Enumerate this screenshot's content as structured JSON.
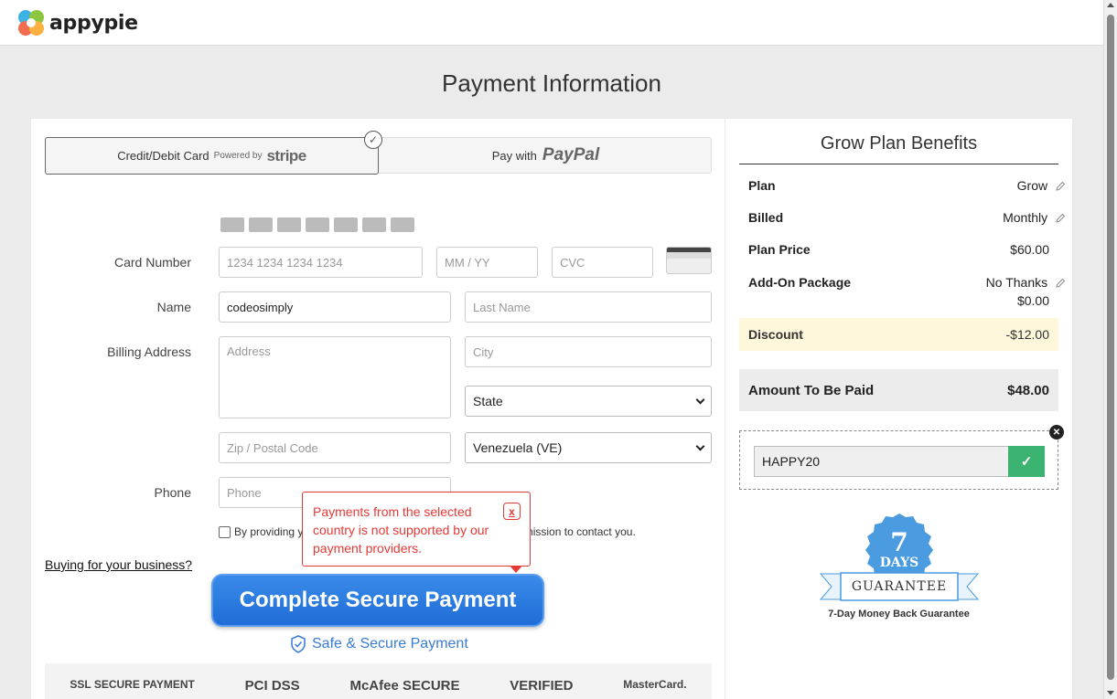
{
  "brand": {
    "name": "appypie"
  },
  "page": {
    "title": "Payment Information"
  },
  "tabs": {
    "card_label": "Credit/Debit Card",
    "powered_by": "Powered by",
    "stripe": "stripe",
    "paypal_prefix": "Pay with",
    "paypal": "PayPal"
  },
  "card_icons": [
    "Maestro",
    "VISA",
    "MasterCard",
    "American Express",
    "Diners",
    "DISCOVER",
    "JCB"
  ],
  "form": {
    "card_number_label": "Card Number",
    "card_number_placeholder": "1234 1234 1234 1234",
    "expiry_placeholder": "MM / YY",
    "cvc_placeholder": "CVC",
    "name_label": "Name",
    "first_name_value": "codeosimply",
    "last_name_placeholder": "Last Name",
    "billing_label": "Billing Address",
    "address_placeholder": "Address",
    "city_placeholder": "City",
    "state_value": "State",
    "zip_placeholder": "Zip / Postal Code",
    "country_value": "Venezuela (VE)",
    "phone_label": "Phone",
    "phone_placeholder": "Phone",
    "consent_start": "By providing y",
    "consent_end": "permission to contact you."
  },
  "business_link": "Buying for your business?",
  "pay_button": "Complete Secure Payment",
  "secure_text": "Safe & Secure Payment",
  "trust_badges": [
    "SSL SECURE PAYMENT",
    "PCI DSS",
    "McAfee SECURE",
    "VERIFIED",
    "MasterCard."
  ],
  "tooltip": {
    "message": "Payments from the selected country is not supported by our payment providers.",
    "close": "x"
  },
  "benefits": {
    "title": "Grow Plan Benefits",
    "plan_label": "Plan",
    "plan_value": "Grow",
    "billed_label": "Billed",
    "billed_value": "Monthly",
    "price_label": "Plan Price",
    "price_value": "$60.00",
    "addon_label": "Add-On Package",
    "addon_value": "No Thanks",
    "addon_price": "$0.00",
    "discount_label": "Discount",
    "discount_value": "-$12.00",
    "amount_label": "Amount To Be Paid",
    "amount_value": "$48.00"
  },
  "coupon": {
    "code": "HAPPY20",
    "apply_icon": "✓"
  },
  "guarantee": {
    "number": "7",
    "days": "DAYS",
    "ribbon": "GUARANTEE",
    "caption": "7-Day Money Back Guarantee"
  },
  "colors": {
    "accent_blue": "#1f6dd6",
    "error_red": "#e53935",
    "success_green": "#3cb371",
    "discount_bg": "#fff7dc"
  }
}
